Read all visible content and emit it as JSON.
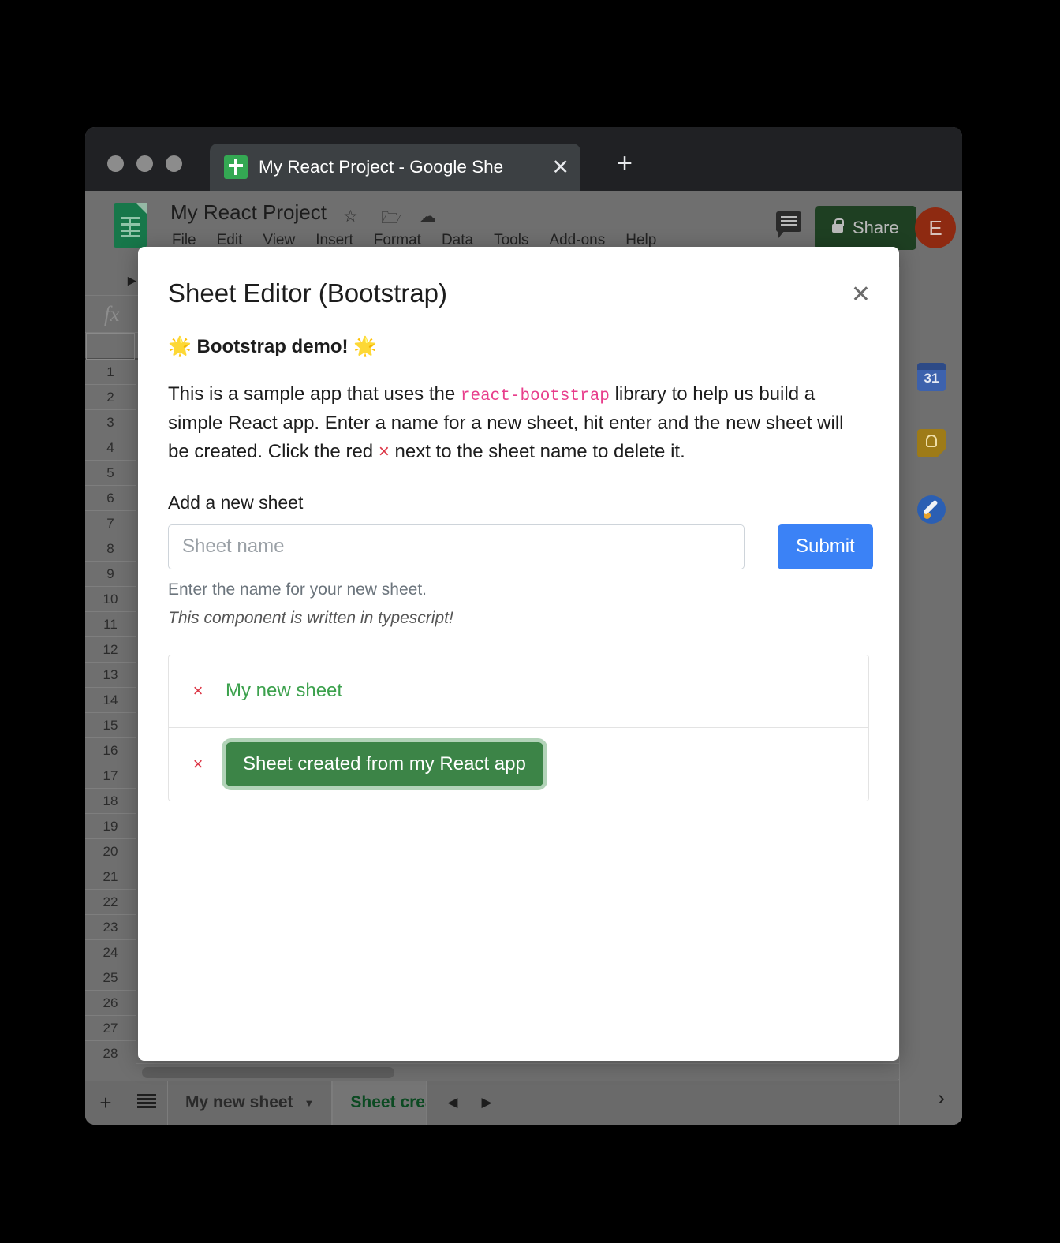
{
  "browser": {
    "tab": {
      "title": "My React Project - Google She",
      "favicon": "sheets-favicon",
      "close_label": "✕"
    },
    "new_tab_label": "+",
    "traffic_lights": [
      "close",
      "minimize",
      "maximize"
    ]
  },
  "sheets": {
    "doc_title": "My React Project",
    "title_icons": [
      "star-icon",
      "move-to-folder-icon",
      "cloud-saved-icon"
    ],
    "menu": [
      "File",
      "Edit",
      "View",
      "Insert",
      "Format",
      "Data",
      "Tools",
      "Add-ons",
      "Help"
    ],
    "comment_icon": "comment-icon",
    "share_label": "Share",
    "share_lock_icon": "lock-icon",
    "avatar_initial": "E",
    "formula_fx": "fx",
    "collapse_arrow": "◄",
    "row_numbers": [
      1,
      2,
      3,
      4,
      5,
      6,
      7,
      8,
      9,
      10,
      11,
      12,
      13,
      14,
      15,
      16,
      17,
      18,
      19,
      20,
      21,
      22,
      23,
      24,
      25,
      26,
      27,
      28
    ],
    "hscroll_left_arrow": "◄",
    "hscroll_right_arrow": "►",
    "sheetbar": {
      "add_label": "+",
      "all_sheets_icon": "all-sheets-icon",
      "tabs": [
        {
          "label": "My new sheet",
          "caret": "▼",
          "active": false
        },
        {
          "label": "Sheet creat",
          "caret": "",
          "active": true
        }
      ],
      "nav_prev": "◀",
      "nav_next": "▶",
      "explore_icon": "explore-icon",
      "explore_glyph": "✦"
    },
    "right_rail": {
      "icons": [
        "calendar-icon",
        "keep-icon",
        "tasks-icon"
      ],
      "calendar_day": "31",
      "expand_arrow": "›"
    }
  },
  "modal": {
    "title": "Sheet Editor (Bootstrap)",
    "close_label": "✕",
    "lead": "🌟 Bootstrap demo! 🌟",
    "paragraph_part1": "This is a sample app that uses the ",
    "paragraph_code": "react-bootstrap",
    "paragraph_part2": " library to help us build a simple React app. Enter a name for a new sheet, hit enter and the new sheet will be created. Click the red ",
    "paragraph_x": "×",
    "paragraph_part3": " next to the sheet name to delete it.",
    "form": {
      "label": "Add a new sheet",
      "input_placeholder": "Sheet name",
      "input_value": "",
      "submit_label": "Submit",
      "help_text": "Enter the name for your new sheet.",
      "typescript_note": "This component is written in typescript!"
    },
    "sheet_list": [
      {
        "delete_label": "×",
        "name": "My new sheet",
        "highlighted": false
      },
      {
        "delete_label": "×",
        "name": "Sheet created from my React app",
        "highlighted": true
      }
    ]
  },
  "colors": {
    "submit_blue": "#3b82f6",
    "sheet_green": "#3ca14d",
    "pill_green": "#3c8447",
    "delete_red": "#dc3545",
    "code_pink": "#e83e8c",
    "share_green": "#1e3f22",
    "avatar_red": "#8e2a11"
  }
}
